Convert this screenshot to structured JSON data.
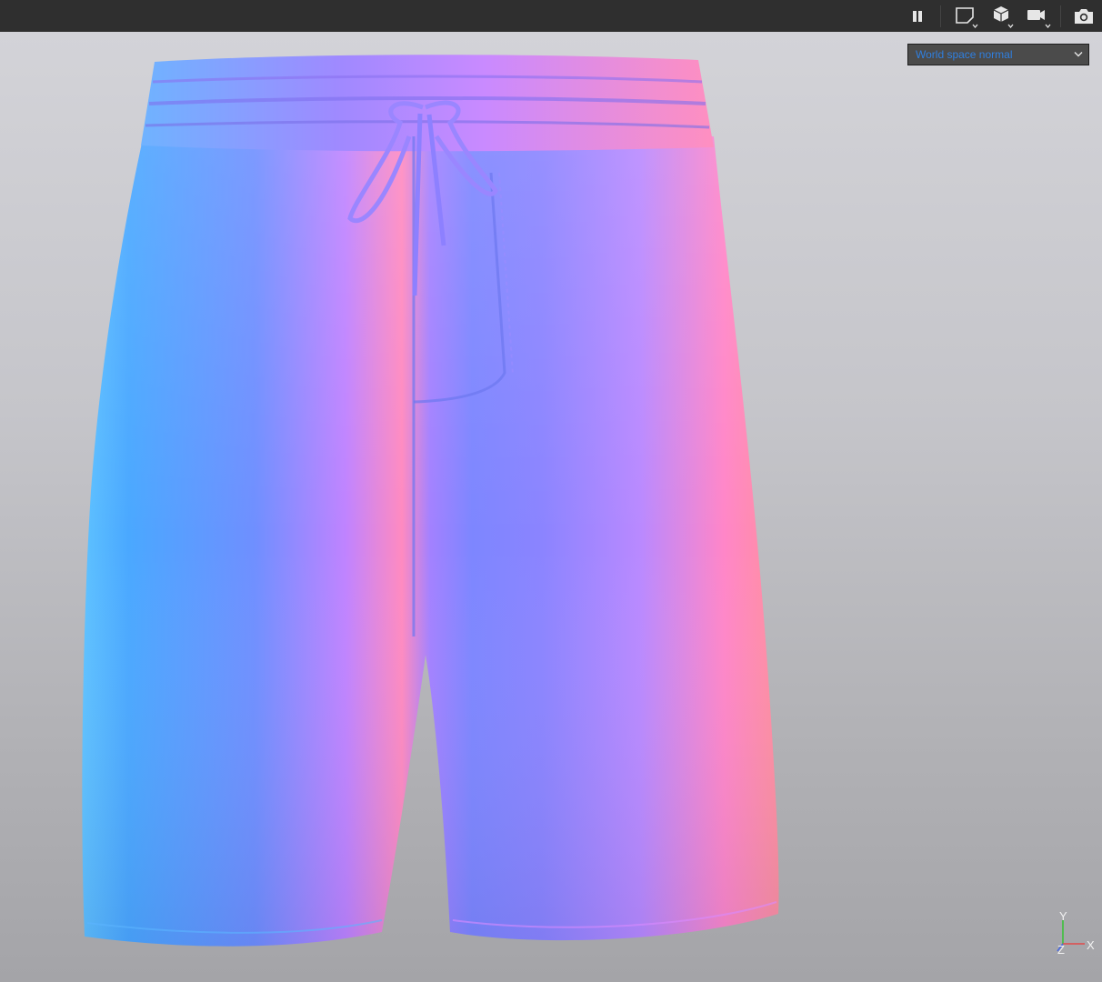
{
  "toolbar": {
    "buttons": [
      {
        "name": "pause",
        "icon": "pause-icon"
      },
      {
        "name": "view",
        "icon": "view-frame-icon"
      },
      {
        "name": "display",
        "icon": "cube-icon"
      },
      {
        "name": "camera",
        "icon": "video-camera-icon"
      },
      {
        "name": "snapshot",
        "icon": "photo-camera-icon"
      }
    ]
  },
  "viewport": {
    "render_mode": {
      "selected": "World space normal"
    },
    "axis_gizmo": {
      "y": "Y",
      "x": "X",
      "z": "Z"
    }
  },
  "colors": {
    "toolbar_bg": "#2f2f2f",
    "select_text": "#2f7fe0",
    "select_bg": "#4b4b4b",
    "axis_y": "#3ac23a",
    "axis_x": "#e04a4a",
    "axis_z": "#4a6ae0"
  }
}
